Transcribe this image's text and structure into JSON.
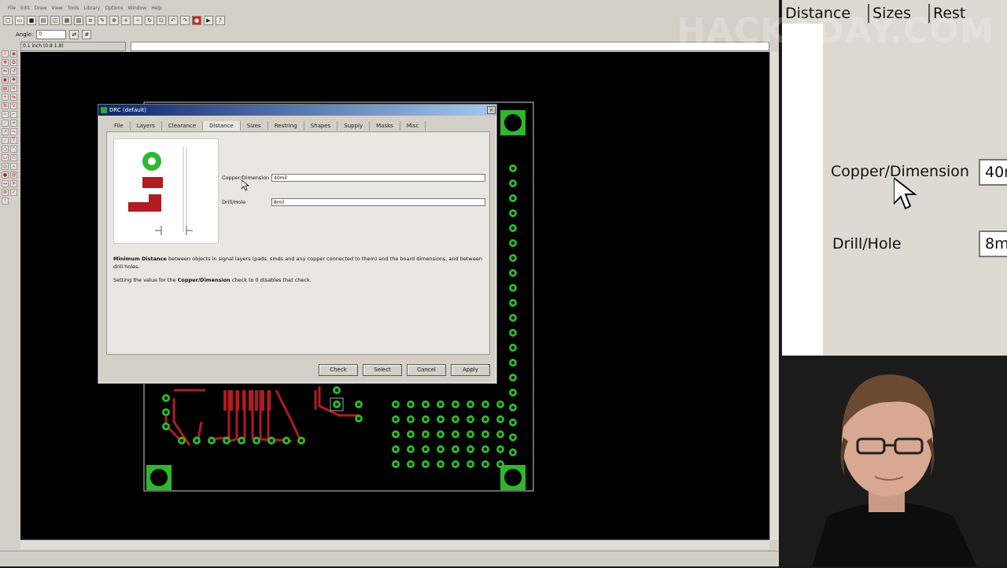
{
  "menu": [
    "File",
    "Edit",
    "Draw",
    "View",
    "Tools",
    "Library",
    "Options",
    "Window",
    "Help"
  ],
  "param_bar": {
    "angle_label": "Angle:",
    "angle_value": "0"
  },
  "coord": "0.1 inch (0.8 1.9)",
  "dialog": {
    "title": "DRC (default)",
    "close": "×",
    "tabs": [
      "File",
      "Layers",
      "Clearance",
      "Distance",
      "Sizes",
      "Restring",
      "Shapes",
      "Supply",
      "Masks",
      "Misc"
    ],
    "active_tab": "Distance",
    "copper_label": "Copper/Dimension",
    "copper_value": "40mil",
    "drill_label": "Drill/Hole",
    "drill_value": "8mil",
    "desc_bold1": "Minimum Distance",
    "desc1": " between objects in signal layers (pads, smds and any copper connected to them) and the board dimensions, and between drill holes.",
    "desc2_pre": "Setting the value for the ",
    "desc2_bold": "Copper/Dimension",
    "desc2_post": " check to 0 disables that check.",
    "buttons": {
      "check": "Check",
      "select": "Select",
      "cancel": "Cancel",
      "apply": "Apply"
    }
  },
  "zoom": {
    "tabs": [
      "Distance",
      "Sizes",
      "Rest"
    ],
    "copper_label": "Copper/Dimension",
    "copper_value": "40m",
    "drill_label": "Drill/Hole",
    "drill_value": "8m"
  },
  "watermark": "HACKADAY.COM",
  "colors": {
    "copper": "#b01c22",
    "pad": "#2db82d",
    "canvas": "#000000",
    "dialog": "#d4d0c8"
  }
}
